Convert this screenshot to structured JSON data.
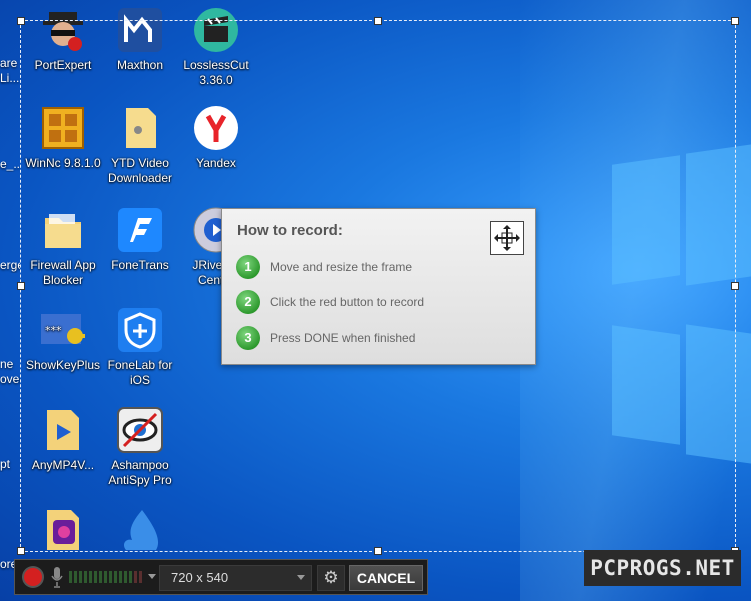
{
  "desktop": {
    "icons": [
      {
        "label": "PortExpert",
        "icon": "spy-icon"
      },
      {
        "label": "Maxthon",
        "icon": "maxthon-icon"
      },
      {
        "label": "LosslessCut 3.36.0",
        "icon": "clapper-icon"
      },
      {
        "label": "WinNc 9.8.1.0",
        "icon": "window-icon"
      },
      {
        "label": "YTD Video Downloader",
        "icon": "folder-icon"
      },
      {
        "label": "Yandex",
        "icon": "yandex-icon"
      },
      {
        "label": "Firewall App Blocker",
        "icon": "folder-icon"
      },
      {
        "label": "FoneTrans",
        "icon": "fonetrans-icon"
      },
      {
        "label": "JRiver M Center",
        "icon": "jriver-icon"
      },
      {
        "label": "ShowKeyPlus",
        "icon": "key-icon"
      },
      {
        "label": "FoneLab for iOS",
        "icon": "fonelab-icon"
      },
      {
        "label": "AnyMP4V...",
        "icon": "anymp4-icon"
      },
      {
        "label": "Ashampoo AntiSpy Pro",
        "icon": "antispy-icon"
      }
    ],
    "edge_labels": [
      "are",
      "Li...",
      "e_...",
      "erge",
      "ne",
      "over",
      "pt",
      "ore"
    ]
  },
  "howto": {
    "title": "How to record:",
    "steps": [
      {
        "num": "1",
        "text": "Move and resize the frame"
      },
      {
        "num": "2",
        "text": "Click the red button to record"
      },
      {
        "num": "3",
        "text": "Press DONE when finished"
      }
    ]
  },
  "toolbar": {
    "resolution": "720 x 540",
    "cancel_label": "CANCEL"
  },
  "watermark": "PCPROGS.NET",
  "colors": {
    "record": "#d42020",
    "step": "#2e9a2e",
    "desktop": "#0a55c2"
  }
}
